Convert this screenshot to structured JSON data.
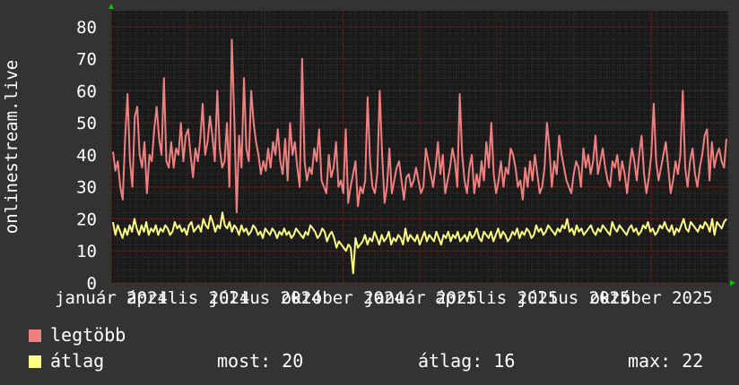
{
  "chart_data": {
    "type": "line",
    "ylabel": "onlinestream.live",
    "ylim": [
      0,
      85
    ],
    "yticks": [
      0,
      10,
      20,
      30,
      40,
      50,
      60,
      70,
      80
    ],
    "xlim": [
      "2024-01-01",
      "2025-12-31"
    ],
    "x_tick_labels": [
      {
        "date": "2024-01-01",
        "label": "január 2024"
      },
      {
        "date": "2024-04-01",
        "label": "április 2024"
      },
      {
        "date": "2024-07-01",
        "label": "július 2024"
      },
      {
        "date": "2024-10-01",
        "label": "október 2024"
      },
      {
        "date": "2025-01-01",
        "label": "január 2025"
      },
      {
        "date": "2025-04-01",
        "label": "április 2025"
      },
      {
        "date": "2025-07-01",
        "label": "július 2025"
      },
      {
        "date": "2025-10-01",
        "label": "október 2025"
      }
    ],
    "grid": true,
    "series": [
      {
        "name": "legtöbb",
        "color": "#f08080",
        "values": [
          41,
          35,
          38,
          30,
          26,
          45,
          59,
          38,
          30,
          52,
          55,
          40,
          36,
          44,
          28,
          40,
          38,
          48,
          55,
          45,
          40,
          64,
          38,
          36,
          44,
          36,
          42,
          40,
          50,
          38,
          46,
          48,
          40,
          33,
          42,
          38,
          45,
          56,
          40,
          44,
          52,
          46,
          38,
          60,
          42,
          36,
          38,
          50,
          30,
          76,
          52,
          22,
          46,
          36,
          64,
          42,
          38,
          60,
          50,
          44,
          40,
          34,
          38,
          35,
          42,
          36,
          44,
          40,
          48,
          38,
          34,
          45,
          32,
          50,
          40,
          44,
          36,
          30,
          70,
          38,
          32,
          36,
          34,
          42,
          38,
          48,
          32,
          30,
          28,
          40,
          33,
          36,
          44,
          30,
          32,
          28,
          48,
          25,
          30,
          34,
          38,
          24,
          30,
          28,
          32,
          58,
          38,
          30,
          28,
          34,
          60,
          40,
          25,
          30,
          42,
          28,
          32,
          36,
          38,
          32,
          26,
          33,
          34,
          30,
          32,
          36,
          32,
          28,
          30,
          42,
          38,
          34,
          30,
          36,
          44,
          34,
          40,
          28,
          32,
          36,
          42,
          38,
          30,
          59,
          40,
          32,
          28,
          36,
          40,
          28,
          34,
          30,
          38,
          32,
          44,
          36,
          50,
          34,
          28,
          32,
          38,
          30,
          36,
          34,
          42,
          40,
          36,
          30,
          32,
          26,
          36,
          30,
          38,
          32,
          40,
          34,
          28,
          30,
          36,
          50,
          42,
          30,
          38,
          34,
          46,
          40,
          36,
          32,
          30,
          28,
          34,
          38,
          36,
          30,
          42,
          36,
          40,
          34,
          38,
          46,
          34,
          38,
          42,
          36,
          32,
          30,
          38,
          36,
          40,
          32,
          38,
          34,
          28,
          36,
          42,
          38,
          32,
          40,
          46,
          34,
          28,
          33,
          40,
          56,
          38,
          32,
          36,
          40,
          44,
          36,
          28,
          32,
          38,
          34,
          40,
          60,
          36,
          30,
          38,
          42,
          34,
          30,
          36,
          40,
          46,
          48,
          32,
          44,
          36,
          40,
          42,
          38,
          36,
          45
        ]
      },
      {
        "name": "átlag",
        "color": "#ffff80",
        "values": [
          19,
          15,
          18,
          16,
          14,
          17,
          15,
          18,
          16,
          20,
          17,
          15,
          18,
          16,
          19,
          15,
          17,
          16,
          18,
          15,
          17,
          16,
          18,
          17,
          15,
          16,
          19,
          17,
          18,
          16,
          17,
          15,
          18,
          19,
          16,
          17,
          18,
          16,
          20,
          18,
          17,
          21,
          19,
          16,
          18,
          17,
          22,
          18,
          17,
          19,
          16,
          18,
          17,
          15,
          18,
          16,
          17,
          15,
          16,
          18,
          17,
          15,
          16,
          14,
          17,
          16,
          15,
          17,
          16,
          14,
          16,
          15,
          17,
          15,
          16,
          14,
          15,
          17,
          16,
          15,
          14,
          16,
          15,
          18,
          17,
          16,
          14,
          15,
          17,
          16,
          13,
          15,
          16,
          14,
          11,
          13,
          12,
          11,
          10,
          12,
          11,
          3,
          14,
          11,
          12,
          13,
          15,
          12,
          14,
          13,
          16,
          14,
          12,
          15,
          13,
          14,
          16,
          12,
          14,
          13,
          15,
          14,
          12,
          17,
          13,
          15,
          14,
          13,
          15,
          12,
          14,
          16,
          13,
          15,
          14,
          13,
          16,
          14,
          12,
          15,
          14,
          16,
          13,
          15,
          14,
          16,
          13,
          14,
          15,
          13,
          16,
          14,
          15,
          17,
          14,
          13,
          16,
          15,
          14,
          16,
          13,
          15,
          17,
          14,
          16,
          15,
          13,
          14,
          16,
          15,
          17,
          14,
          16,
          15,
          17,
          16,
          14,
          15,
          18,
          16,
          17,
          15,
          16,
          18,
          17,
          16,
          15,
          17,
          16,
          18,
          17,
          20,
          16,
          17,
          15,
          18,
          16,
          17,
          15,
          16,
          17,
          18,
          16,
          15,
          17,
          16,
          18,
          17,
          16,
          15,
          19,
          17,
          16,
          18,
          17,
          16,
          15,
          17,
          18,
          16,
          17,
          15,
          16,
          18,
          17,
          19,
          16,
          17,
          15,
          16,
          18,
          17,
          19,
          17,
          16,
          18,
          15,
          17,
          16,
          18,
          20,
          17,
          16,
          19,
          18,
          17,
          16,
          18,
          17,
          19,
          18,
          16,
          20,
          15,
          19,
          18,
          17,
          19,
          20
        ]
      }
    ]
  },
  "legend": {
    "max_label": "legtöbb",
    "avg_label": "átlag"
  },
  "stats": {
    "now": "most: 20",
    "avg": "átlag: 16",
    "max": "max: 22"
  },
  "colors": {
    "background": "#333333",
    "plot_background": "#1a1a1a",
    "grid_major": "#5a2a2a",
    "grid_minor": "#3a3a3a",
    "axis_arrow": "#00cc00",
    "max_series": "#f08080",
    "avg_series": "#ffff80"
  }
}
